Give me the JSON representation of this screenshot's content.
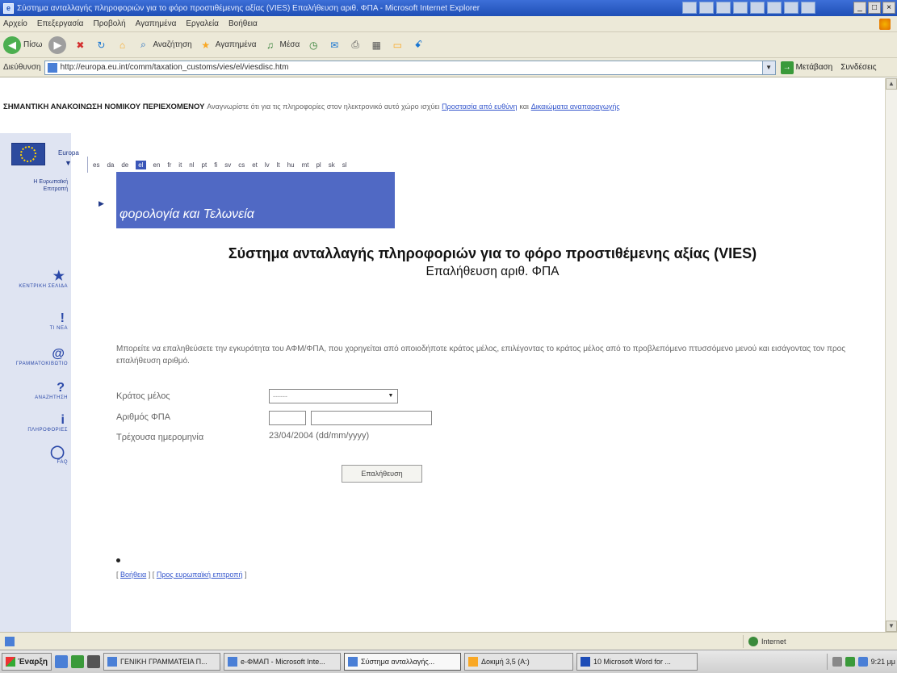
{
  "window": {
    "title": "Σύστημα ανταλλαγής πληροφοριών για το φόρο προστιθέμενης αξίας (VIES) Επαλήθευση αριθ. ΦΠΑ - Microsoft Internet Explorer",
    "buttons": [
      "_",
      "□",
      "×"
    ]
  },
  "menu": [
    "Αρχείο",
    "Επεξεργασία",
    "Προβολή",
    "Αγαπημένα",
    "Εργαλεία",
    "Βοήθεια"
  ],
  "toolbar": {
    "back_label": "Πίσω",
    "search_label": "Αναζήτηση",
    "favorites_label": "Αγαπημένα",
    "media_label": "Μέσα"
  },
  "address": {
    "label": "Διεύθυνση",
    "url": "http://europa.eu.int/comm/taxation_customs/vies/el/viesdisc.htm",
    "go_label": "Μετάβαση",
    "links_label": "Συνδέσεις"
  },
  "notice": {
    "bold": "ΣΗΜΑΝΤΙΚΗ ΑΝΑΚΟΙΝΩΣΗ ΝΟΜΙΚΟΥ ΠΕΡΙΕΧΟΜΕΝΟΥ",
    "text": "Αναγνωρίστε ότι για τις πληροφορίες στον ηλεκτρονικό αυτό χώρο ισχύει",
    "link1": "Προστασία από ευθύνη",
    "conj": "και",
    "link2": "Δικαιώματα αναπαραγωγής"
  },
  "sidebar": {
    "europa": "Europa",
    "commission": "Η Ευρωπαϊκή Επιτροπή",
    "items": [
      {
        "icon": "★",
        "label": "ΚΕΝΤΡΙΚΗ ΣΕΛΙΔΑ"
      },
      {
        "icon": "!",
        "label": "ΤΙ ΝΕΑ"
      },
      {
        "icon": "@",
        "label": "ΓΡΑΜΜΑΤΟΚΙΒΩΤΙΟ"
      },
      {
        "icon": "?",
        "label": "ΑΝΑΖΗΤΗΣΗ"
      },
      {
        "icon": "i",
        "label": "ΠΛΗΡΟΦΟΡΙΕΣ"
      },
      {
        "icon": "◯",
        "label": "FAQ"
      }
    ]
  },
  "languages": [
    "es",
    "da",
    "de",
    "el",
    "en",
    "fr",
    "it",
    "nl",
    "pt",
    "fi",
    "sv",
    "cs",
    "et",
    "lv",
    "lt",
    "hu",
    "mt",
    "pl",
    "sk",
    "sl"
  ],
  "banner": {
    "text": "φορολογία και Τελωνεία"
  },
  "heading": {
    "line1": "Σύστημα ανταλλαγής πληροφοριών για το φόρο προστιθέμενης αξίας (VIES)",
    "line2": "Επαλήθευση αριθ. ΦΠΑ"
  },
  "intro": "Μπορείτε να επαληθεύσετε την εγκυρότητα του ΑΦΜ/ΦΠΑ, που χορηγείται από οποιοδήποτε κράτος μέλος, επιλέγοντας το κράτος μέλος από το προβλεπόμενο πτυσσόμενο μενού και εισάγοντας τον προς επαλήθευση αριθμό.",
  "form": {
    "member_state_label": "Κράτος μέλος",
    "member_state_value": "------",
    "vat_label": "Αριθμός ΦΠΑ",
    "date_label": "Τρέχουσα ημερομηνία",
    "date_value": "23/04/2004 (dd/mm/yyyy)",
    "verify_label": "Επαλήθευση"
  },
  "footer": {
    "open": "[",
    "link1": "Βοήθεια",
    "sep": "] [",
    "link2": "Προς ευρωπαϊκή επιτροπή",
    "close": "]"
  },
  "status": {
    "zone": "Internet"
  },
  "taskbar": {
    "start": "Έναρξη",
    "tasks": [
      "ΓΕΝΙΚΗ ΓΡΑΜΜΑΤΕΙΑ Π...",
      "e-ΦΜΑΠ - Microsoft Inte...",
      "Σύστημα ανταλλαγής...",
      "Δοκιμή 3,5 (A:)",
      "10 Microsoft Word for ..."
    ],
    "time": "9:21 μμ"
  }
}
